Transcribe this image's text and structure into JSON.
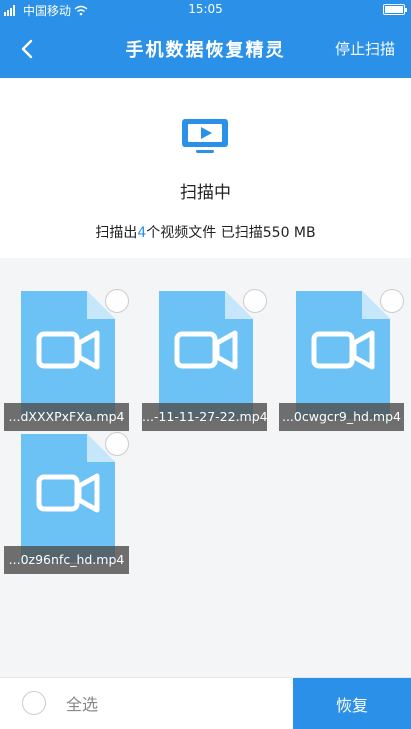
{
  "status_bar": {
    "carrier": "中国移动",
    "time": "15:05"
  },
  "header": {
    "title": "手机数据恢复精灵",
    "stop_label": "停止扫描"
  },
  "scan": {
    "status": "扫描中",
    "summary_prefix": "扫描出",
    "found_count": "4",
    "summary_middle": "个视频文件 已扫描",
    "scanned_size": "550 MB"
  },
  "files": [
    {
      "name": "...dXXXPxFXa.mp4"
    },
    {
      "name": "...-11-11-27-22.mp4"
    },
    {
      "name": "...0cwgcr9_hd.mp4"
    },
    {
      "name": "...0z96nfc_hd.mp4"
    }
  ],
  "bottom": {
    "select_all_label": "全选",
    "recover_label": "恢复"
  },
  "colors": {
    "accent": "#2a90e8",
    "file_icon": "#6cc2f5",
    "file_fold": "#c5e6fb"
  },
  "icons": {
    "back": "chevron-left-icon",
    "scan": "tv-play-icon",
    "file": "video-file-icon"
  }
}
